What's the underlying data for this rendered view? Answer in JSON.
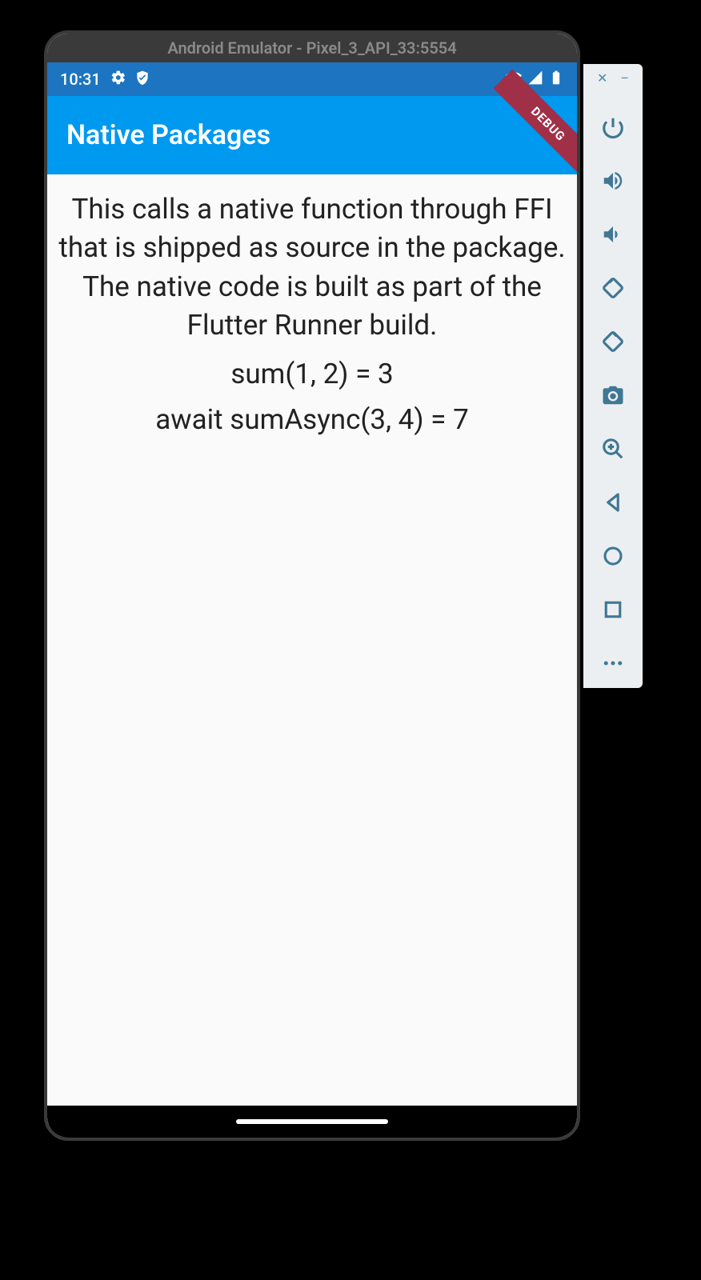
{
  "emulator": {
    "title": "Android Emulator - Pixel_3_API_33:5554"
  },
  "statusbar": {
    "time": "10:31"
  },
  "appbar": {
    "title": "Native Packages",
    "debug_label": "DEBUG"
  },
  "content": {
    "description": "This calls a native function through FFI that is shipped as source in the package. The native code is built as part of the Flutter Runner build.",
    "result1": "sum(1, 2) = 3",
    "result2": "await sumAsync(3, 4) = 7"
  },
  "toolbar": {
    "close": "✕",
    "minimize": "–"
  }
}
